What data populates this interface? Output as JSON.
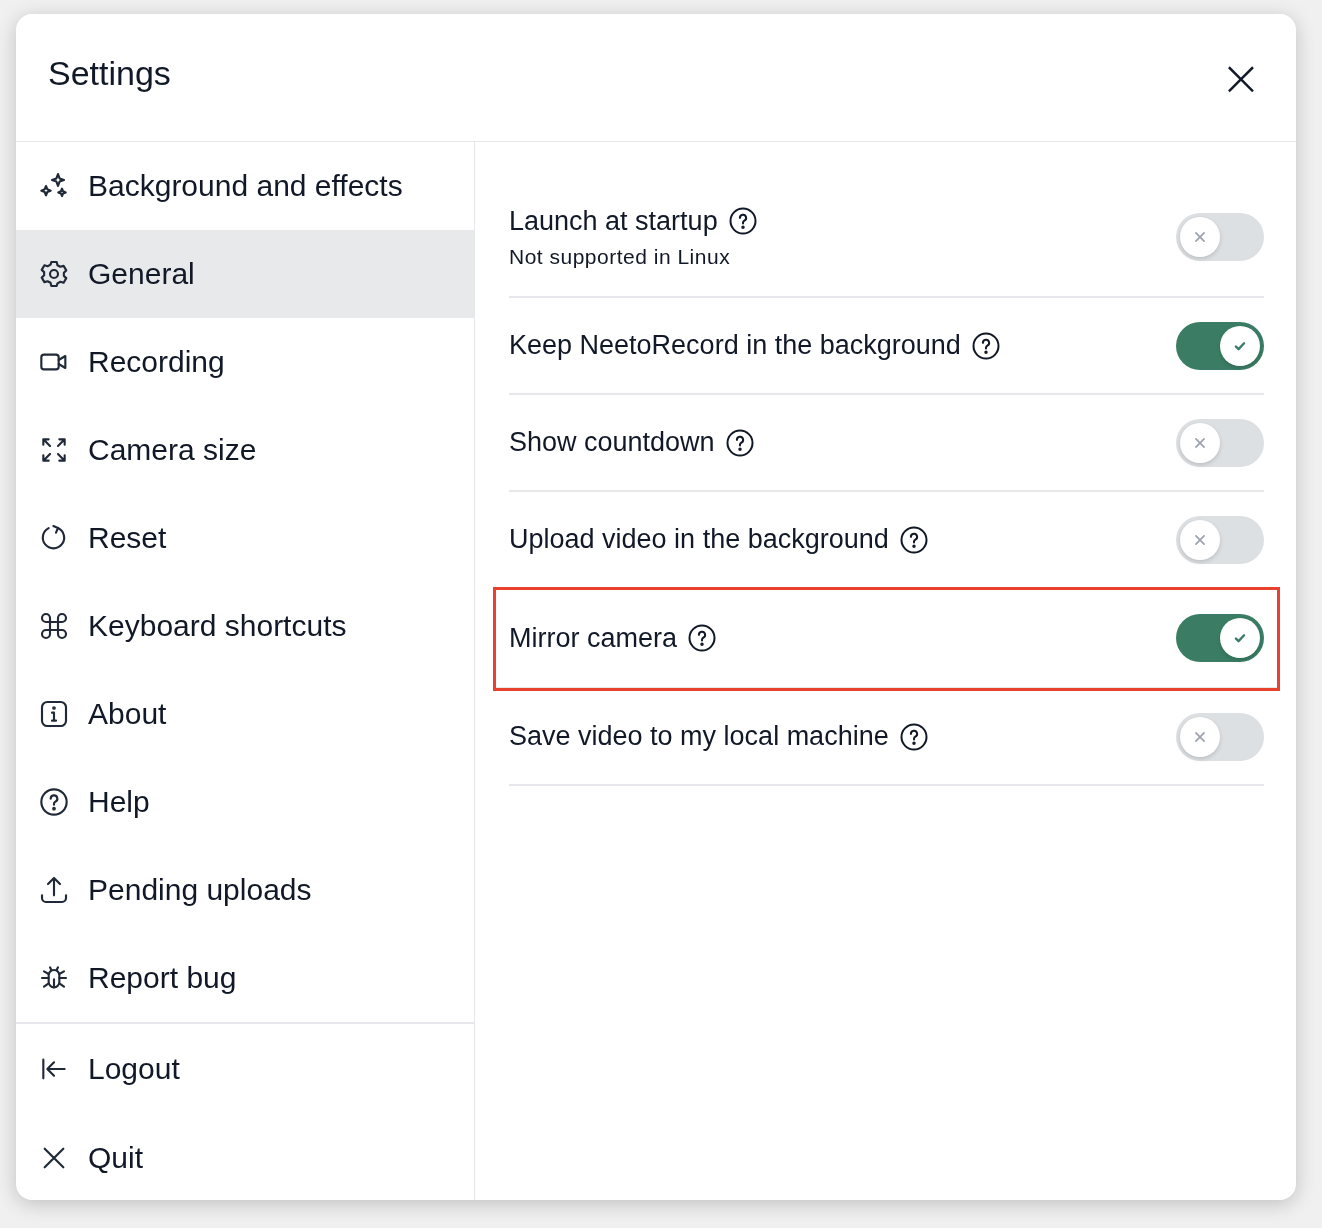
{
  "window": {
    "title": "Settings",
    "close": "×"
  },
  "sidebar": {
    "items": [
      {
        "label": "Background and effects",
        "selected": false
      },
      {
        "label": "General",
        "selected": true
      },
      {
        "label": "Recording",
        "selected": false
      },
      {
        "label": "Camera size",
        "selected": false
      },
      {
        "label": "Reset",
        "selected": false
      },
      {
        "label": "Keyboard shortcuts",
        "selected": false
      },
      {
        "label": "About",
        "selected": false
      },
      {
        "label": "Help",
        "selected": false
      },
      {
        "label": "Pending uploads",
        "selected": false
      },
      {
        "label": "Report bug",
        "selected": false
      }
    ],
    "footer_items": [
      {
        "label": "Logout",
        "selected": false
      },
      {
        "label": "Quit",
        "selected": false
      }
    ]
  },
  "settings": [
    {
      "label": "Launch at startup",
      "note": "Not supported in Linux",
      "on": false,
      "highlighted": false
    },
    {
      "label": "Keep NeetoRecord in the background",
      "on": true,
      "highlighted": false
    },
    {
      "label": "Show countdown",
      "on": false,
      "highlighted": false
    },
    {
      "label": "Upload video in the background",
      "on": false,
      "highlighted": false
    },
    {
      "label": "Mirror camera",
      "on": true,
      "highlighted": true
    },
    {
      "label": "Save video to my local machine",
      "on": false,
      "highlighted": false
    }
  ]
}
